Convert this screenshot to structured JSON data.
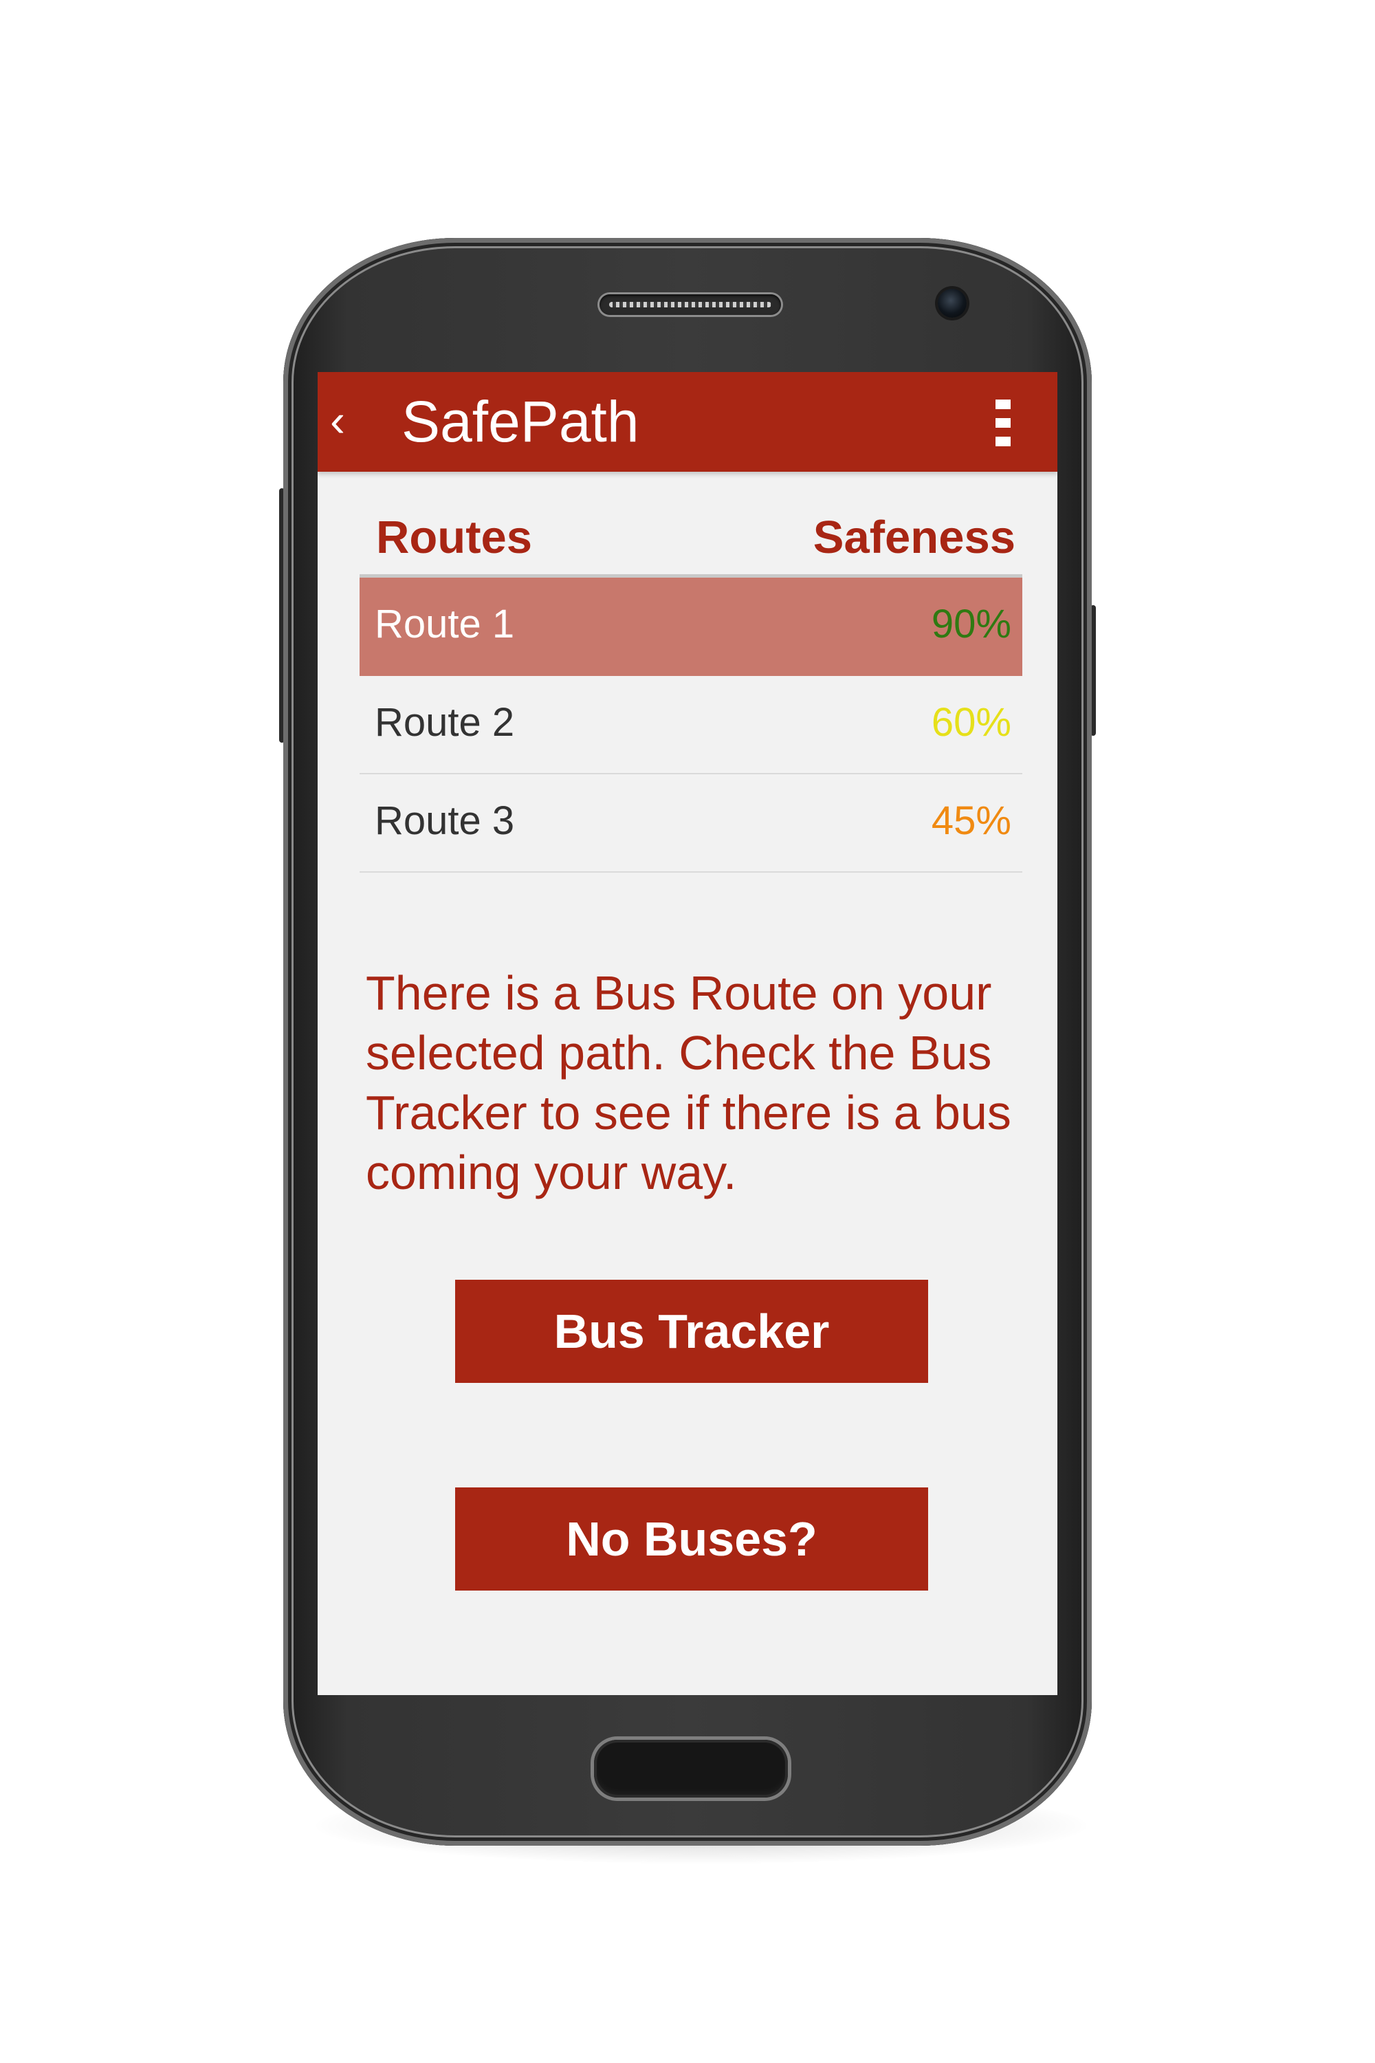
{
  "app": {
    "title": "SafePath",
    "back_icon": "chevron-left-icon",
    "back_glyph": "‹",
    "overflow_icon": "more-vert-icon"
  },
  "table": {
    "headers": {
      "routes": "Routes",
      "safeness": "Safeness"
    },
    "rows": [
      {
        "name": "Route 1",
        "safeness": "90%",
        "color": "#2f7a12",
        "selected": true
      },
      {
        "name": "Route 2",
        "safeness": "60%",
        "color": "#e6e01a",
        "selected": false
      },
      {
        "name": "Route 3",
        "safeness": "45%",
        "color": "#f08a12",
        "selected": false
      }
    ]
  },
  "message": "There is a Bus Route on your selected path. Check the Bus Tracker to see if there is a bus coming your way.",
  "buttons": {
    "bus_tracker": "Bus Tracker",
    "no_buses": "No Buses?"
  },
  "colors": {
    "brand": "#a82614",
    "selected_row": "#c8786c",
    "screen_background": "#f2f2f2"
  }
}
